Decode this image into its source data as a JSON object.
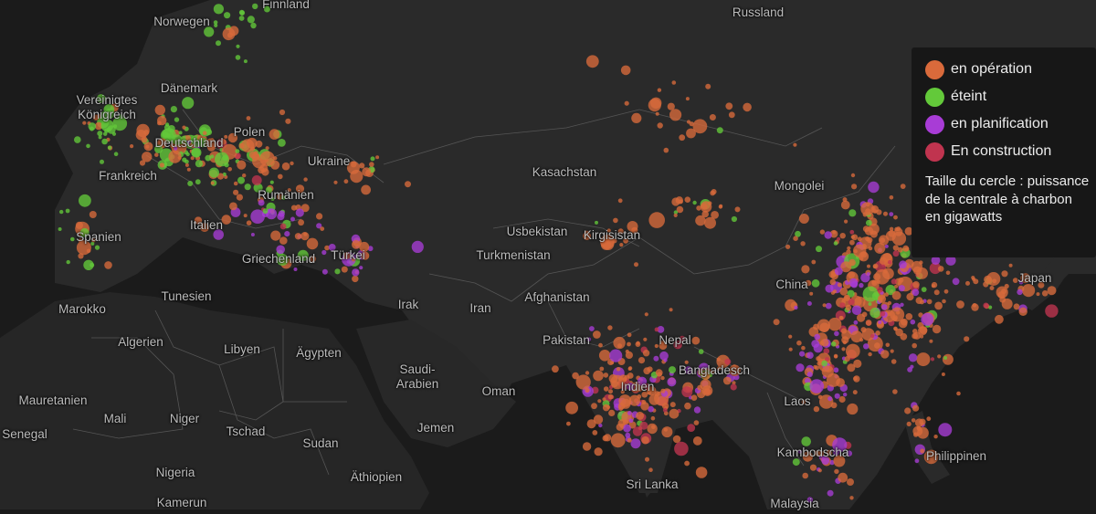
{
  "map": {
    "country_labels": [
      {
        "id": "norwegen",
        "text": "Norwegen"
      },
      {
        "id": "finnland",
        "text": "Finnland"
      },
      {
        "id": "russland",
        "text": "Russland"
      },
      {
        "id": "vereinigtes-koenigreich",
        "text": "Vereinigtes\nKönigreich"
      },
      {
        "id": "daenemark",
        "text": "Dänemark"
      },
      {
        "id": "deutschland",
        "text": "Deutschland"
      },
      {
        "id": "polen",
        "text": "Polen"
      },
      {
        "id": "ukraine",
        "text": "Ukraine"
      },
      {
        "id": "frankreich",
        "text": "Frankreich"
      },
      {
        "id": "rumaenien",
        "text": "Rumänien"
      },
      {
        "id": "italien",
        "text": "Italien"
      },
      {
        "id": "spanien",
        "text": "Spanien"
      },
      {
        "id": "griechenland",
        "text": "Griechenland"
      },
      {
        "id": "tuerkei",
        "text": "Türkei"
      },
      {
        "id": "kasachstan",
        "text": "Kasachstan"
      },
      {
        "id": "mongolei",
        "text": "Mongolei"
      },
      {
        "id": "usbekistan",
        "text": "Usbekistan"
      },
      {
        "id": "kirgisistan",
        "text": "Kirgisistan"
      },
      {
        "id": "turkmenistan",
        "text": "Turkmenistan"
      },
      {
        "id": "china",
        "text": "China"
      },
      {
        "id": "japan",
        "text": "Japan"
      },
      {
        "id": "tunesien",
        "text": "Tunesien"
      },
      {
        "id": "marokko",
        "text": "Marokko"
      },
      {
        "id": "irak",
        "text": "Irak"
      },
      {
        "id": "iran",
        "text": "Iran"
      },
      {
        "id": "afghanistan",
        "text": "Afghanistan"
      },
      {
        "id": "algerien",
        "text": "Algerien"
      },
      {
        "id": "libyen",
        "text": "Libyen"
      },
      {
        "id": "aegypten",
        "text": "Ägypten"
      },
      {
        "id": "pakistan",
        "text": "Pakistan"
      },
      {
        "id": "nepal",
        "text": "Nepal"
      },
      {
        "id": "saudi-arabien",
        "text": "Saudi-\nArabien"
      },
      {
        "id": "bangladesch",
        "text": "Bangladesch"
      },
      {
        "id": "mauretanien",
        "text": "Mauretanien"
      },
      {
        "id": "mali",
        "text": "Mali"
      },
      {
        "id": "niger",
        "text": "Niger"
      },
      {
        "id": "tschad",
        "text": "Tschad"
      },
      {
        "id": "indien",
        "text": "Indien"
      },
      {
        "id": "oman",
        "text": "Oman"
      },
      {
        "id": "laos",
        "text": "Laos"
      },
      {
        "id": "senegal",
        "text": "Senegal"
      },
      {
        "id": "jemen",
        "text": "Jemen"
      },
      {
        "id": "sudan",
        "text": "Sudan"
      },
      {
        "id": "kambodscha",
        "text": "Kambodscha"
      },
      {
        "id": "philippinen",
        "text": "Philippinen"
      },
      {
        "id": "nigeria",
        "text": "Nigeria"
      },
      {
        "id": "aethiopien",
        "text": "Äthiopien"
      },
      {
        "id": "sri-lanka",
        "text": "Sri Lanka"
      },
      {
        "id": "kamerun",
        "text": "Kamerun"
      },
      {
        "id": "malaysia",
        "text": "Malaysia"
      }
    ]
  },
  "legend": {
    "items": [
      {
        "label": "en opération",
        "color": "#d96a3b"
      },
      {
        "label": "éteint",
        "color": "#63c93a"
      },
      {
        "label": "en planification",
        "color": "#a83cd6"
      },
      {
        "label": "En construction",
        "color": "#c0344f"
      }
    ],
    "size_note": "Taille du cercle : puissance de la centrale à charbon en gigawatts"
  },
  "colors": {
    "background": "#1b1b1b",
    "land": "#292929",
    "border": "#565656"
  }
}
